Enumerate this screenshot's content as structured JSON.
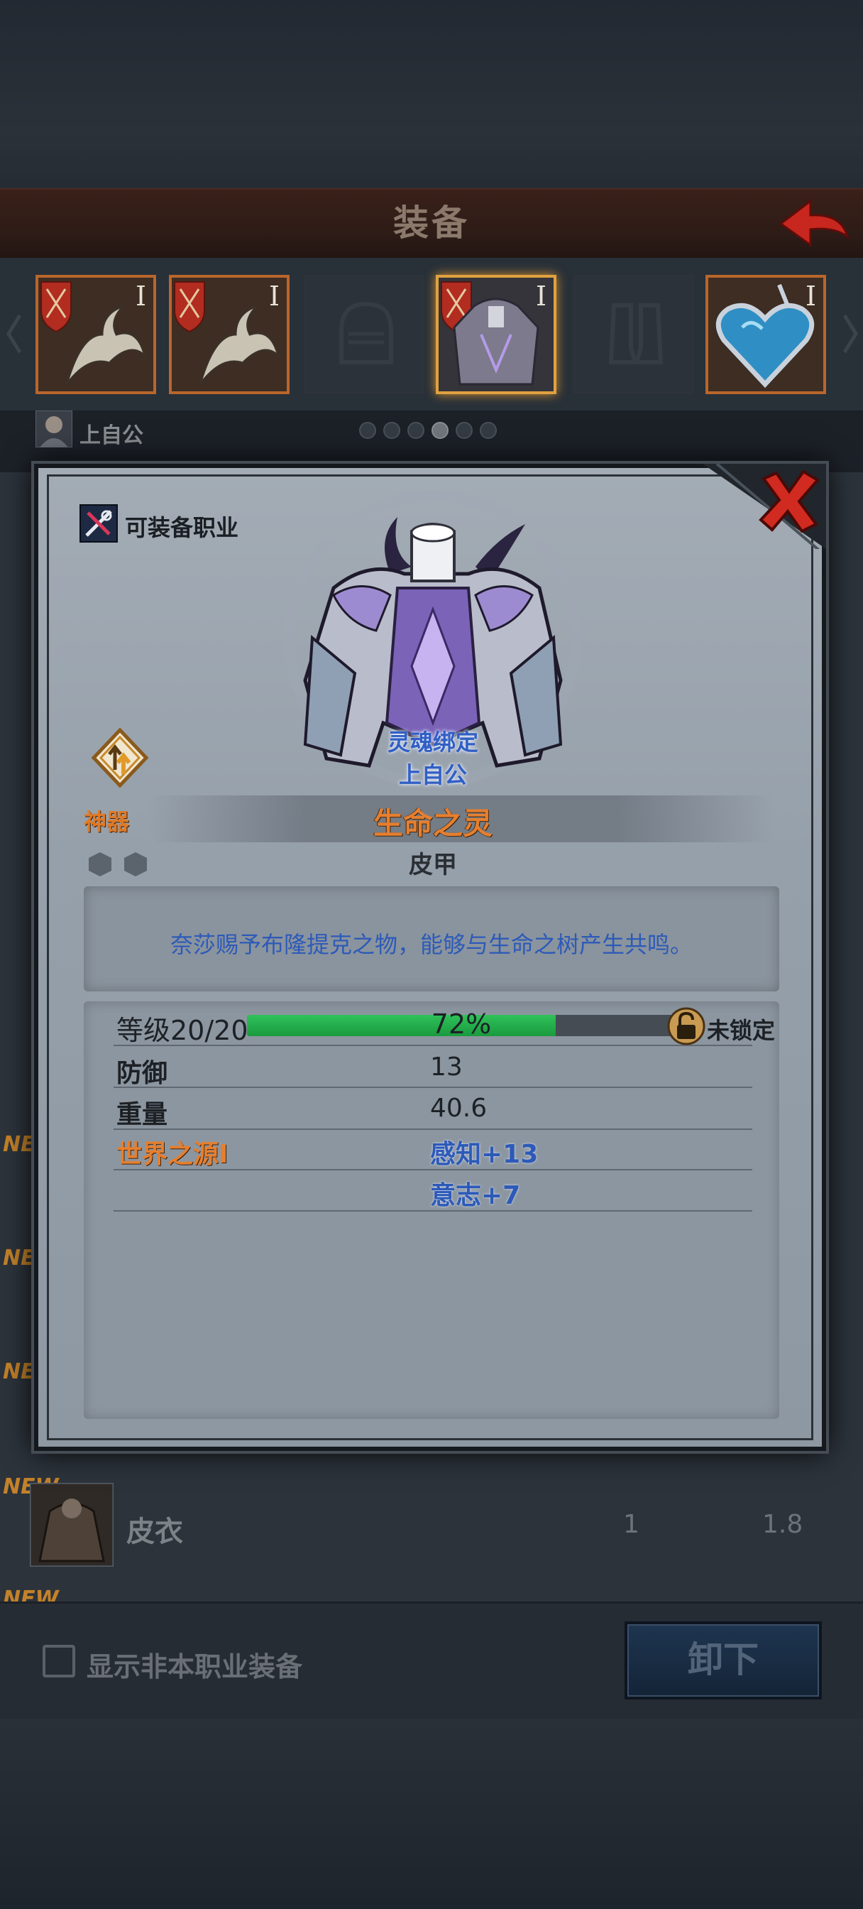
{
  "header": {
    "title": "装备"
  },
  "slots": [
    {
      "kind": "weapon",
      "roman": "I"
    },
    {
      "kind": "weapon",
      "roman": "I"
    },
    {
      "kind": "helmet",
      "roman": ""
    },
    {
      "kind": "armor",
      "roman": "I"
    },
    {
      "kind": "boots",
      "roman": ""
    },
    {
      "kind": "amulet",
      "roman": "I"
    }
  ],
  "owner_row": {
    "name": "上自公"
  },
  "pager": {
    "total": 6,
    "current": 4
  },
  "list": {
    "new_tag": "NEW",
    "item": {
      "name": "皮衣",
      "col1": "1",
      "col2": "1.8"
    }
  },
  "bottom": {
    "checkbox_label": "显示非本职业装备",
    "unequip_label": "卸下"
  },
  "dialog": {
    "class_label": "可装备职业",
    "bound_text": "灵魂绑定",
    "owner": "上自公",
    "artifact_label": "神器",
    "item_name": "生命之灵",
    "item_type": "皮甲",
    "description": "奈莎赐予布隆提克之物，能够与生命之树产生共鸣。",
    "level": {
      "label": "等级20/20",
      "progress_percent": 72,
      "percent_text": "72%",
      "lock_label": "未锁定"
    },
    "stats": [
      {
        "name": "防御",
        "value": "13"
      },
      {
        "name": "重量",
        "value": "40.6"
      },
      {
        "name": "世界之源Ⅰ",
        "value": "感知+13"
      },
      {
        "name": "",
        "value": "意志+7"
      }
    ]
  },
  "colors": {
    "accent_orange": "#e57f2f",
    "stat_blue": "#2d5ab8",
    "progress_green": "#2fc25a"
  }
}
